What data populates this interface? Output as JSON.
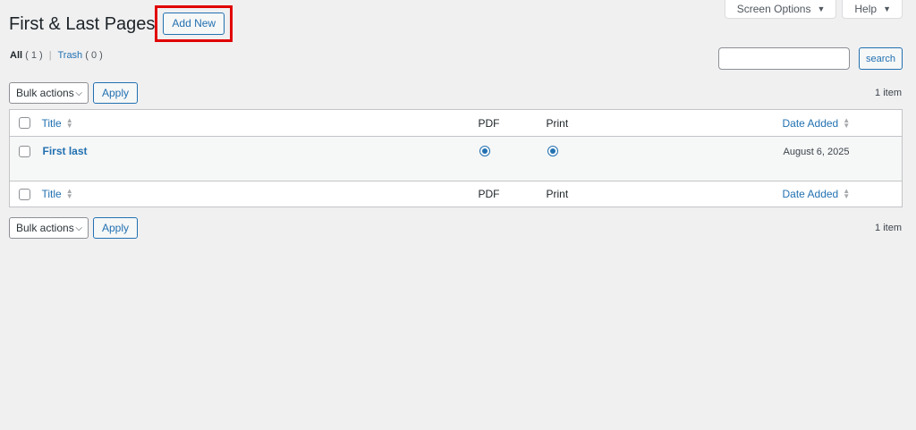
{
  "screen_tabs": {
    "screen_options": "Screen Options",
    "help": "Help"
  },
  "header": {
    "title": "First & Last Pages",
    "add_new": "Add New"
  },
  "views": {
    "all_label": "All",
    "all_count": "( 1 )",
    "separator": "|",
    "trash_label": "Trash",
    "trash_count": "( 0 )"
  },
  "search": {
    "value": "",
    "button": "search"
  },
  "tablenav": {
    "bulk_actions": "Bulk actions",
    "apply": "Apply",
    "items_count": "1 item"
  },
  "table": {
    "columns": {
      "title": "Title",
      "pdf": "PDF",
      "print": "Print",
      "date_added": "Date Added"
    },
    "rows": [
      {
        "title": "First last",
        "pdf_selected": true,
        "print_selected": true,
        "date_added": "August 6, 2025"
      }
    ]
  },
  "colors": {
    "accent": "#2271b1",
    "highlight": "#e10000",
    "background": "#f0f0f1"
  }
}
